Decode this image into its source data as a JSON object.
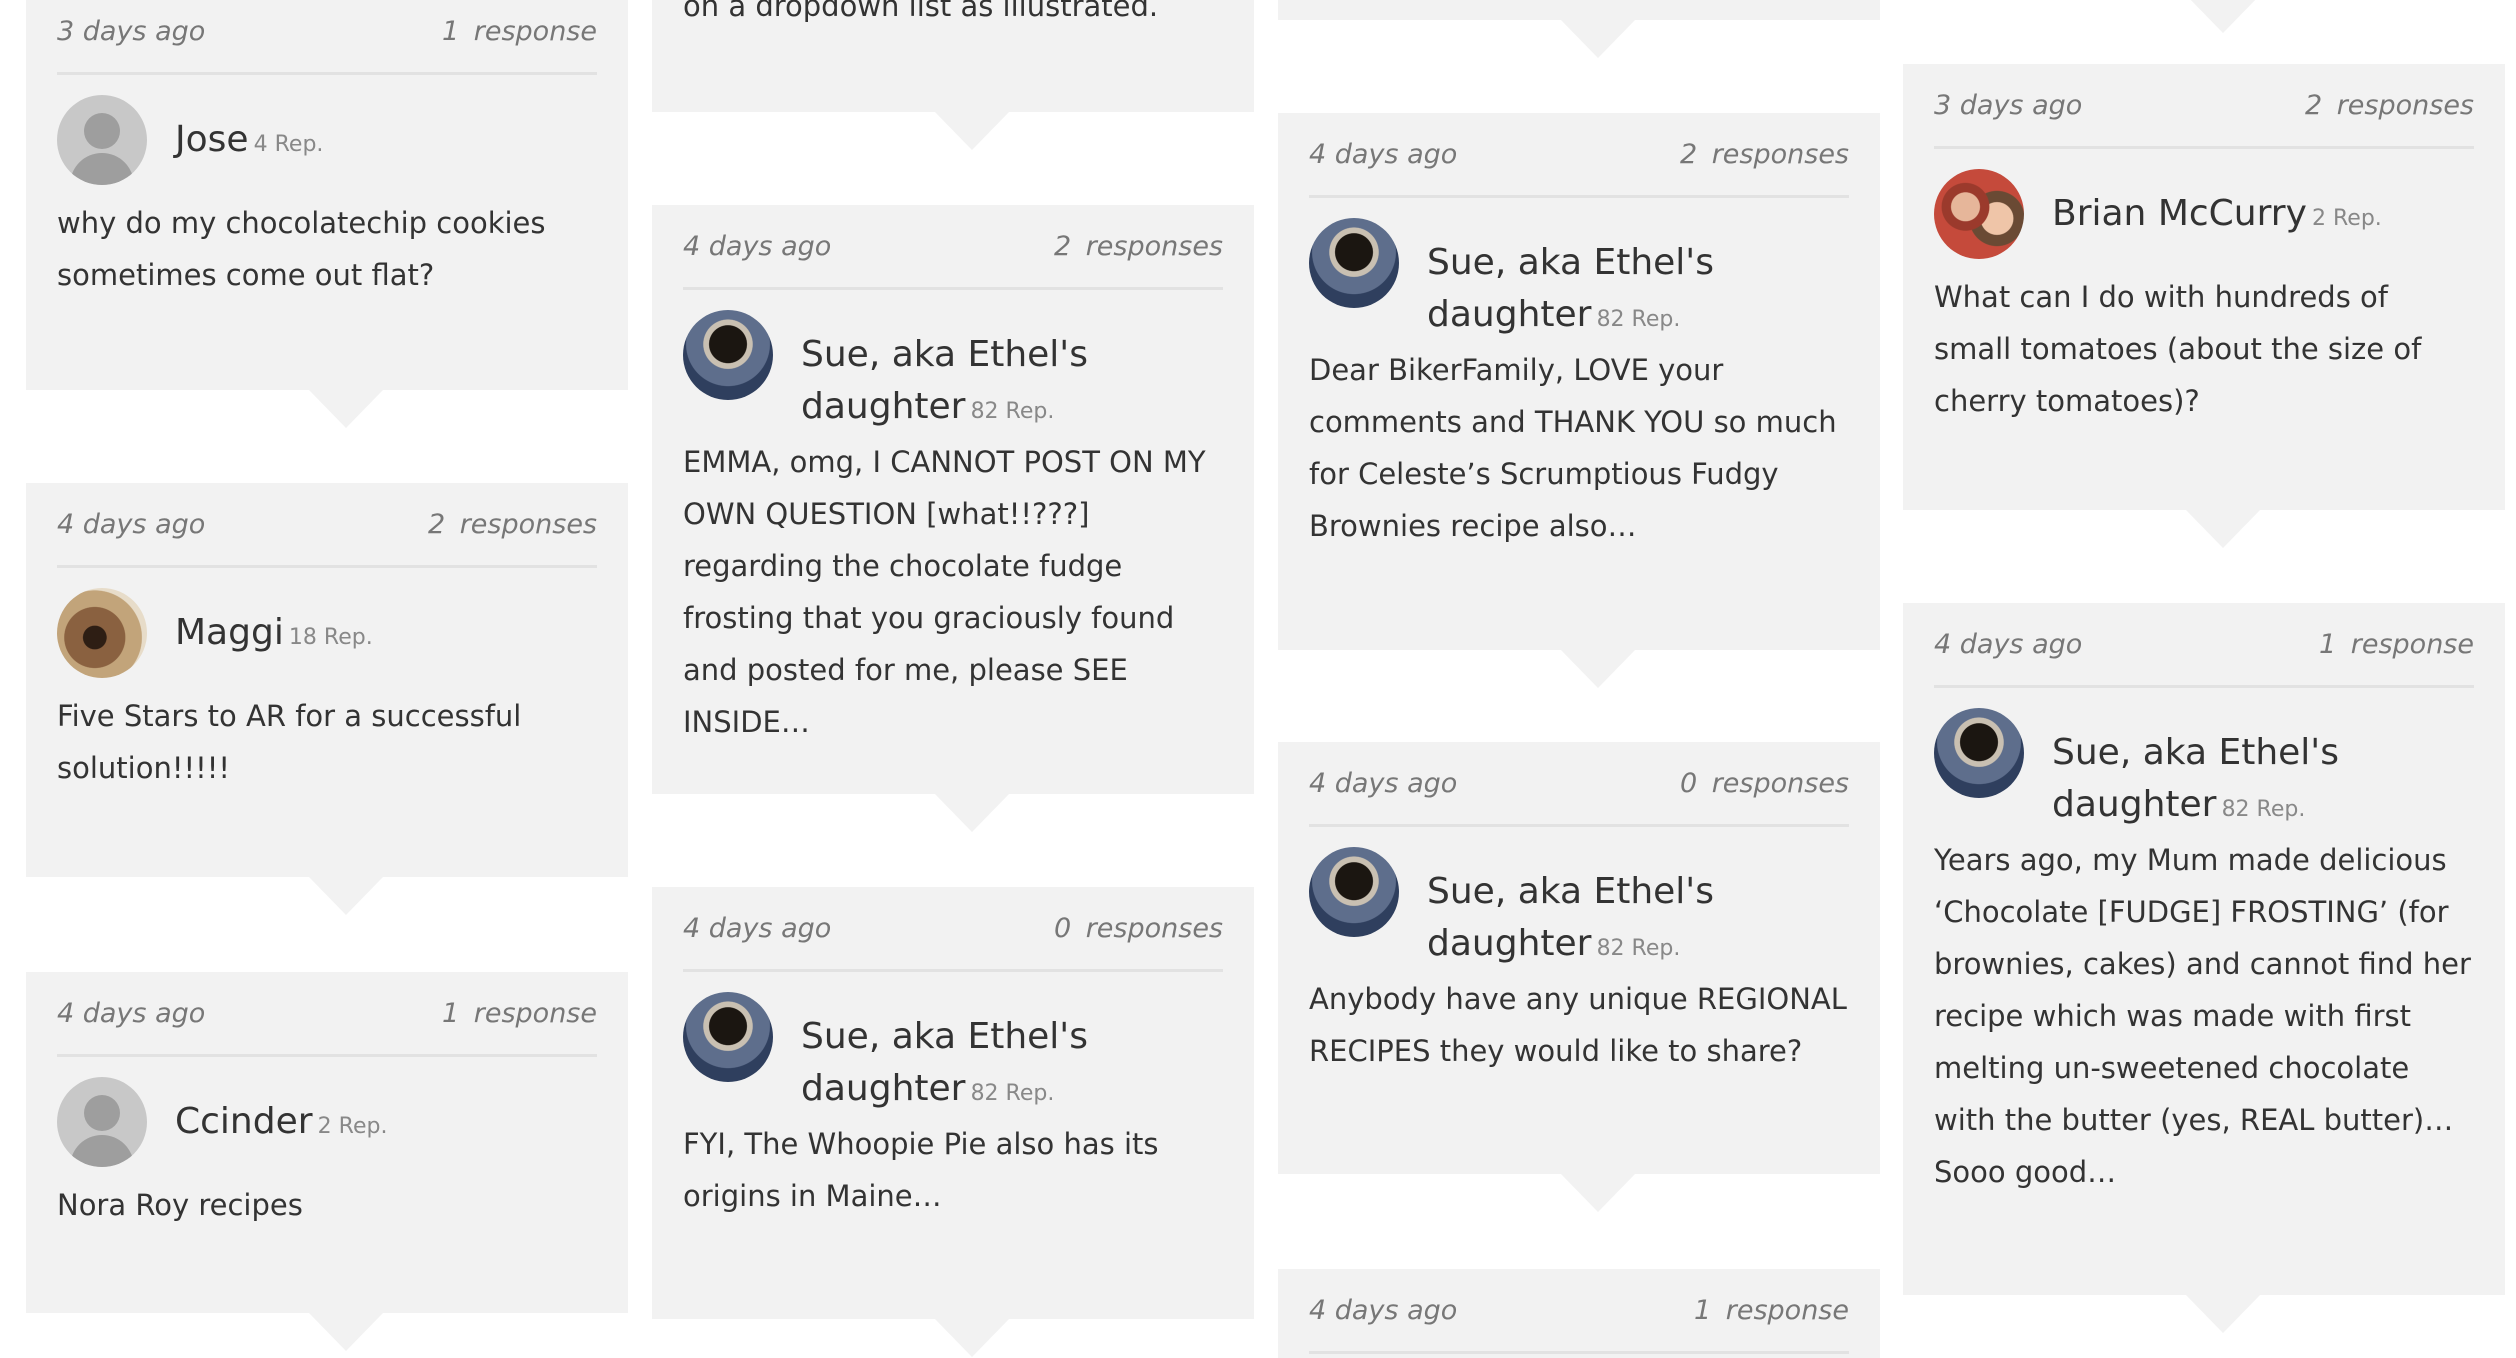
{
  "cards": [
    {
      "time": "3 days ago",
      "responses": "1 response",
      "author": "Jose",
      "rep": "4 Rep.",
      "avatar": "default-user-icon",
      "text": "why do my chocolatechip cookies sometimes come out flat?"
    },
    {
      "time": "4 days ago",
      "responses": "2 responses",
      "author": "Maggi",
      "rep": "18 Rep.",
      "avatar": "dog-photo",
      "text": "Five Stars to AR for a successful solution!!!!!"
    },
    {
      "time": "4 days ago",
      "responses": "1 response",
      "author": "Ccinder",
      "rep": "2 Rep.",
      "avatar": "default-user-icon",
      "text": "Nora Roy recipes"
    },
    {
      "text": "on a dropdown list as illustrated."
    },
    {
      "time": "4 days ago",
      "responses": "2 responses",
      "author": "Sue, aka Ethel's daughter",
      "rep": "82 Rep.",
      "avatar": "coffee-cup-photo",
      "text": "EMMA, omg, I CANNOT POST ON MY OWN QUESTION [what!!???] regarding the chocolate fudge frosting that you graciously found and posted for me, please SEE INSIDE…"
    },
    {
      "time": "4 days ago",
      "responses": "0 responses",
      "author": "Sue, aka Ethel's daughter",
      "rep": "82 Rep.",
      "avatar": "coffee-cup-photo",
      "text": "FYI, The Whoopie Pie also has its origins in Maine…"
    },
    {
      "time": "4 days ago",
      "responses": "2 responses",
      "author": "Sue, aka Ethel's daughter",
      "rep": "82 Rep.",
      "avatar": "coffee-cup-photo",
      "text": "Dear BikerFamily, LOVE your comments and THANK YOU so much for Celeste’s Scrumptious Fudgy Brownies recipe also…"
    },
    {
      "time": "4 days ago",
      "responses": "0 responses",
      "author": "Sue, aka Ethel's daughter",
      "rep": "82 Rep.",
      "avatar": "coffee-cup-photo",
      "text": "Anybody have any unique REGIONAL RECIPES they would like to share?"
    },
    {
      "time": "4 days ago",
      "responses": "1 response"
    },
    {
      "time": "3 days ago",
      "responses": "2 responses",
      "author": "Brian McCurry",
      "rep": "2 Rep.",
      "avatar": "family-photo",
      "text": "What can I do with hundreds of small tomatoes (about the size of cherry tomatoes)?"
    },
    {
      "time": "4 days ago",
      "responses": "1 response",
      "author": "Sue, aka Ethel's daughter",
      "rep": "82 Rep.",
      "avatar": "coffee-cup-photo",
      "text": "Years ago, my Mum made delicious ‘Chocolate [FUDGE] FROSTING’ (for brownies, cakes) and cannot find her recipe which was made with first melting un-sweetened chocolate with the butter (yes, REAL butter)… Sooo good…"
    }
  ]
}
